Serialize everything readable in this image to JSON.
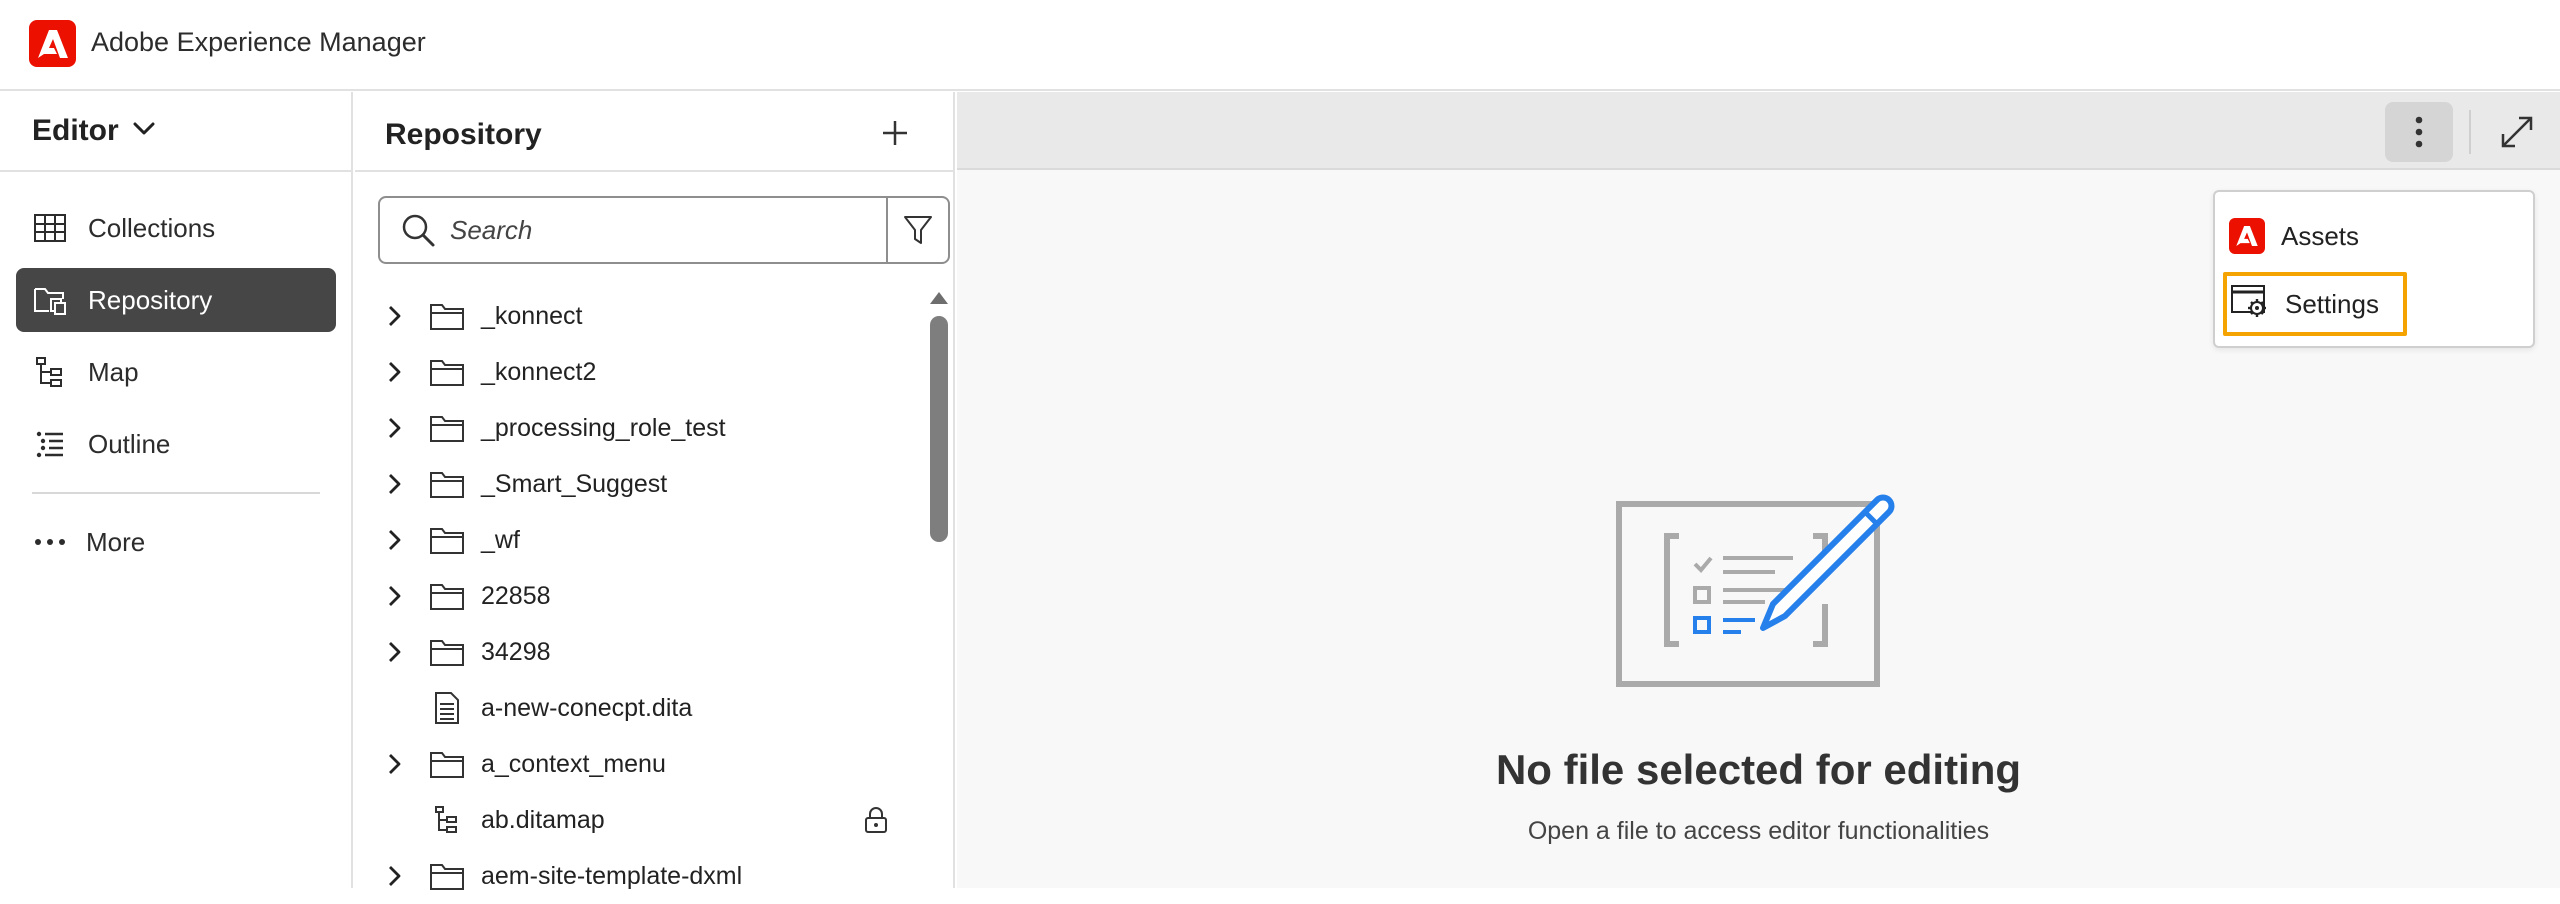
{
  "app": {
    "title": "Adobe Experience Manager"
  },
  "leftnav": {
    "switcher_label": "Editor",
    "items": [
      {
        "label": "Collections",
        "icon": "collections-grid-icon",
        "active": false
      },
      {
        "label": "Repository",
        "icon": "repository-icon",
        "active": true
      },
      {
        "label": "Map",
        "icon": "map-tree-icon",
        "active": false
      },
      {
        "label": "Outline",
        "icon": "outline-list-icon",
        "active": false
      }
    ],
    "more_label": "More"
  },
  "repository": {
    "title": "Repository",
    "search_placeholder": "Search",
    "items": [
      {
        "name": "_konnect",
        "type": "folder"
      },
      {
        "name": "_konnect2",
        "type": "folder"
      },
      {
        "name": "_processing_role_test",
        "type": "folder"
      },
      {
        "name": "_Smart_Suggest",
        "type": "folder"
      },
      {
        "name": "_wf",
        "type": "folder"
      },
      {
        "name": "22858",
        "type": "folder"
      },
      {
        "name": "34298",
        "type": "folder"
      },
      {
        "name": "a-new-conecpt.dita",
        "type": "file"
      },
      {
        "name": "a_context_menu",
        "type": "folder"
      },
      {
        "name": "ab.ditamap",
        "type": "map",
        "locked": true
      },
      {
        "name": "aem-site-template-dxml",
        "type": "folder"
      }
    ]
  },
  "menu": {
    "items": [
      {
        "label": "Assets",
        "icon": "adobe-assets-icon"
      },
      {
        "label": "Settings",
        "icon": "settings-window-icon",
        "highlighted": true
      }
    ]
  },
  "empty_state": {
    "title": "No file selected for editing",
    "subtitle": "Open a file to access editor functionalities"
  },
  "colors": {
    "adobe_red": "#eb1000",
    "active_nav_bg": "#464646",
    "highlight_border": "#f5a300",
    "illustration_blue": "#2680eb"
  }
}
